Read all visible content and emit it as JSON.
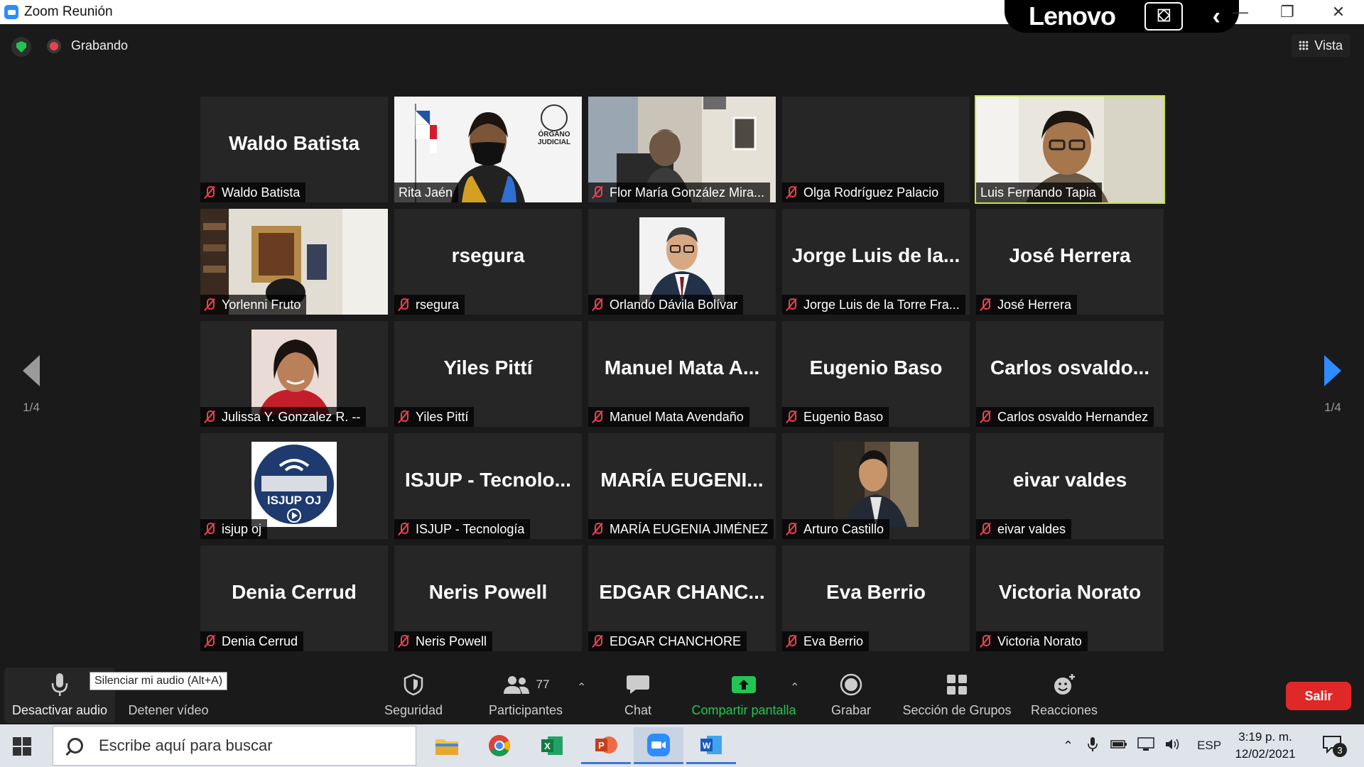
{
  "window": {
    "title": "Zoom Reunión"
  },
  "overlay": {
    "brand": "Lenovo"
  },
  "meeting": {
    "recording_label": "Grabando",
    "view_label": "Vista"
  },
  "nav": {
    "prev_page": "1/4",
    "next_page": "1/4"
  },
  "tiles": [
    {
      "big": "Waldo Batista",
      "label": "Waldo Batista",
      "muted": true
    },
    {
      "big": "",
      "label": "Rita Jaén",
      "muted": false,
      "photo": "rita",
      "logo_line1": "ÓRGANO",
      "logo_line2": "JUDICIAL"
    },
    {
      "big": "",
      "label": "Flor María González Mira...",
      "muted": true,
      "photo": "flor"
    },
    {
      "big": "",
      "label": "Olga Rodríguez Palacio",
      "muted": true
    },
    {
      "big": "",
      "label": "Luis Fernando Tapia",
      "muted": false,
      "photo": "luis",
      "active": true
    },
    {
      "big": "",
      "label": "Yorlenni Fruto",
      "muted": true,
      "photo": "yorlenni"
    },
    {
      "big": "rsegura",
      "label": "rsegura",
      "muted": true
    },
    {
      "big": "",
      "label": "Orlando Dávila Bolívar",
      "muted": true,
      "photo": "orlando"
    },
    {
      "big": "Jorge Luis de la...",
      "label": "Jorge Luis de la Torre Fra...",
      "muted": true
    },
    {
      "big": "José Herrera",
      "label": "José Herrera",
      "muted": true
    },
    {
      "big": "",
      "label": "Julissa Y. Gonzalez R. --",
      "muted": true,
      "photo": "julissa"
    },
    {
      "big": "Yiles Pittí",
      "label": "Yiles Pittí",
      "muted": true
    },
    {
      "big": "Manuel Mata A...",
      "label": "Manuel Mata Avendaño",
      "muted": true
    },
    {
      "big": "Eugenio Baso",
      "label": "Eugenio Baso",
      "muted": true
    },
    {
      "big": "Carlos osvaldo...",
      "label": "Carlos osvaldo Hernandez",
      "muted": true
    },
    {
      "big": "",
      "label": "isjup oj",
      "muted": true,
      "photo": "isjup",
      "logo_text": "ISJUP OJ"
    },
    {
      "big": "ISJUP - Tecnolo...",
      "label": "ISJUP - Tecnología",
      "muted": true
    },
    {
      "big": "MARÍA EUGENI...",
      "label": "MARÍA EUGENIA JIMÉNEZ",
      "muted": true
    },
    {
      "big": "",
      "label": "Arturo Castillo",
      "muted": true,
      "photo": "arturo"
    },
    {
      "big": "eivar valdes",
      "label": "eivar valdes",
      "muted": true
    },
    {
      "big": "Denia Cerrud",
      "label": "Denia Cerrud",
      "muted": true
    },
    {
      "big": "Neris Powell",
      "label": "Neris Powell",
      "muted": true
    },
    {
      "big": "EDGAR CHANC...",
      "label": "EDGAR CHANCHORE",
      "muted": true
    },
    {
      "big": "Eva Berrio",
      "label": "Eva Berrio",
      "muted": true
    },
    {
      "big": "Victoria Norato",
      "label": "Victoria Norato",
      "muted": true
    }
  ],
  "toolbar": {
    "audio": "Desactivar audio",
    "audio_tooltip": "Silenciar mi audio (Alt+A)",
    "video": "Detener vídeo",
    "security": "Seguridad",
    "participants": "Participantes",
    "participants_count": "77",
    "chat": "Chat",
    "share": "Compartir pantalla",
    "record": "Grabar",
    "breakout": "Sección de Grupos",
    "reactions": "Reacciones",
    "leave": "Salir"
  },
  "taskbar": {
    "search_placeholder": "Escribe aquí para buscar",
    "lang": "ESP",
    "time": "3:19 p. m.",
    "date": "12/02/2021",
    "notifications": "3"
  },
  "colors": {
    "accent": "#2d8cff",
    "active_speaker": "#c5e642",
    "muted": "#e8434d",
    "share": "#23c552",
    "leave": "#e02828"
  }
}
